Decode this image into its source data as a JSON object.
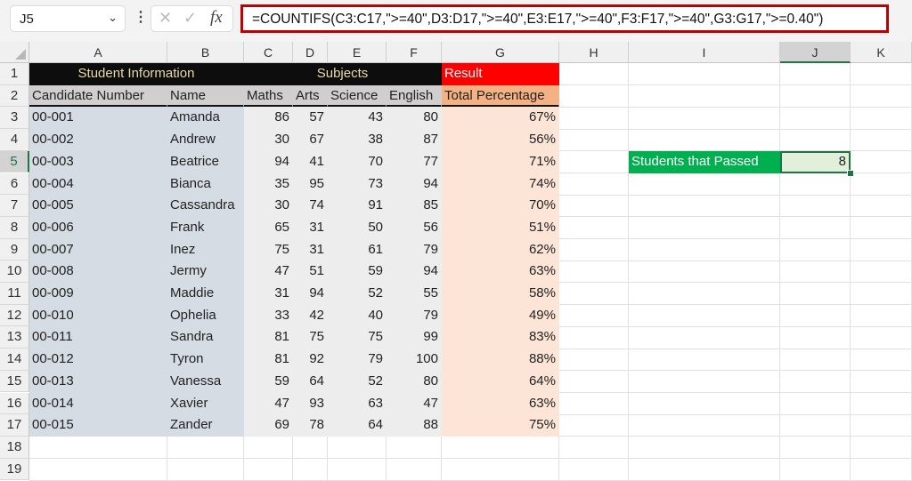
{
  "formula_bar": {
    "name_box": "J5",
    "chevron": "⌄",
    "dots": "⋮",
    "cancel_icon": "✕",
    "enter_icon": "✓",
    "fx_label": "fx",
    "formula": "=COUNTIFS(C3:C17,\">=40\",D3:D17,\">=40\",E3:E17,\">=40\",F3:F17,\">=40\",G3:G17,\">=0.40\")"
  },
  "columns": [
    "A",
    "B",
    "C",
    "D",
    "E",
    "F",
    "G",
    "H",
    "I",
    "J",
    "K"
  ],
  "selected_column": "J",
  "selected_row": 5,
  "rows": [
    "1",
    "2",
    "3",
    "4",
    "5",
    "6",
    "7",
    "8",
    "9",
    "10",
    "11",
    "12",
    "13",
    "14",
    "15",
    "16",
    "17",
    "18",
    "19"
  ],
  "section_headers": {
    "student_information": "Student Information",
    "subjects": "Subjects",
    "result": "Result"
  },
  "table_headers": [
    "Candidate Number",
    "Name",
    "Maths",
    "Arts",
    "Science",
    "English",
    "Total Percentage"
  ],
  "students": [
    {
      "id": "00-001",
      "name": "Amanda",
      "maths": "86",
      "arts": "57",
      "science": "43",
      "english": "80",
      "total": "67%"
    },
    {
      "id": "00-002",
      "name": "Andrew",
      "maths": "30",
      "arts": "67",
      "science": "38",
      "english": "87",
      "total": "56%"
    },
    {
      "id": "00-003",
      "name": "Beatrice",
      "maths": "94",
      "arts": "41",
      "science": "70",
      "english": "77",
      "total": "71%"
    },
    {
      "id": "00-004",
      "name": "Bianca",
      "maths": "35",
      "arts": "95",
      "science": "73",
      "english": "94",
      "total": "74%"
    },
    {
      "id": "00-005",
      "name": "Cassandra",
      "maths": "30",
      "arts": "74",
      "science": "91",
      "english": "85",
      "total": "70%"
    },
    {
      "id": "00-006",
      "name": "Frank",
      "maths": "65",
      "arts": "31",
      "science": "50",
      "english": "56",
      "total": "51%"
    },
    {
      "id": "00-007",
      "name": "Inez",
      "maths": "75",
      "arts": "31",
      "science": "61",
      "english": "79",
      "total": "62%"
    },
    {
      "id": "00-008",
      "name": "Jermy",
      "maths": "47",
      "arts": "51",
      "science": "59",
      "english": "94",
      "total": "63%"
    },
    {
      "id": "00-009",
      "name": "Maddie",
      "maths": "31",
      "arts": "94",
      "science": "52",
      "english": "55",
      "total": "58%"
    },
    {
      "id": "00-010",
      "name": "Ophelia",
      "maths": "33",
      "arts": "42",
      "science": "40",
      "english": "79",
      "total": "49%"
    },
    {
      "id": "00-011",
      "name": "Sandra",
      "maths": "81",
      "arts": "75",
      "science": "75",
      "english": "99",
      "total": "83%"
    },
    {
      "id": "00-012",
      "name": "Tyron",
      "maths": "81",
      "arts": "92",
      "science": "79",
      "english": "100",
      "total": "88%"
    },
    {
      "id": "00-013",
      "name": "Vanessa",
      "maths": "59",
      "arts": "64",
      "science": "52",
      "english": "80",
      "total": "64%"
    },
    {
      "id": "00-014",
      "name": "Xavier",
      "maths": "47",
      "arts": "93",
      "science": "63",
      "english": "47",
      "total": "63%"
    },
    {
      "id": "00-015",
      "name": "Zander",
      "maths": "69",
      "arts": "78",
      "science": "64",
      "english": "88",
      "total": "75%"
    }
  ],
  "summary": {
    "label": "Students that Passed",
    "value": "8"
  }
}
